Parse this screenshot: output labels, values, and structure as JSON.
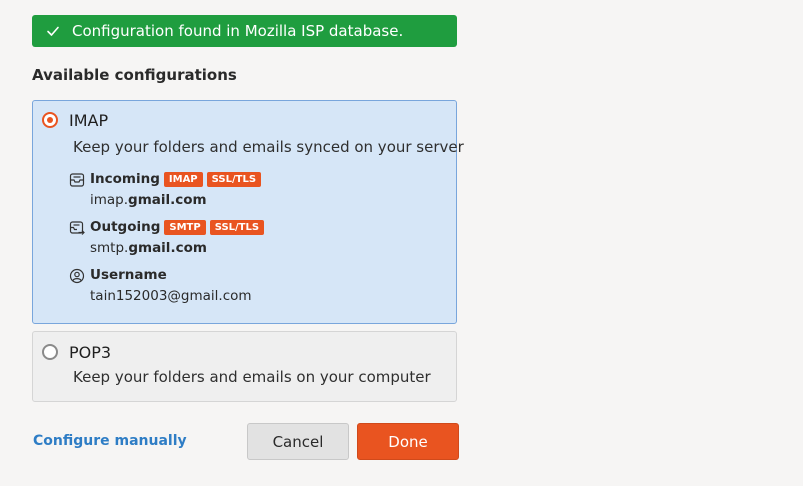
{
  "banner": {
    "text": "Configuration found in Mozilla ISP database.",
    "icon": "checkmark-icon",
    "color": "#1f9d3f"
  },
  "section": {
    "title": "Available configurations"
  },
  "imap": {
    "title": "IMAP",
    "description": "Keep your folders and emails synced on your server",
    "selected": true,
    "incoming": {
      "label": "Incoming",
      "badges": [
        "IMAP",
        "SSL/TLS"
      ],
      "host_prefix": "imap.",
      "host_domain": "gmail.com"
    },
    "outgoing": {
      "label": "Outgoing",
      "badges": [
        "SMTP",
        "SSL/TLS"
      ],
      "host_prefix": "smtp.",
      "host_domain": "gmail.com"
    },
    "username": {
      "label": "Username",
      "value": "tain152003@gmail.com"
    }
  },
  "pop3": {
    "title": "POP3",
    "description": "Keep your folders and emails on your computer",
    "selected": false
  },
  "footer": {
    "configure_manually": "Configure manually",
    "cancel": "Cancel",
    "done": "Done"
  },
  "colors": {
    "accent": "#e95420",
    "link": "#2e7dc5",
    "selected_bg": "#d6e6f7",
    "selected_border": "#79a6dc"
  }
}
